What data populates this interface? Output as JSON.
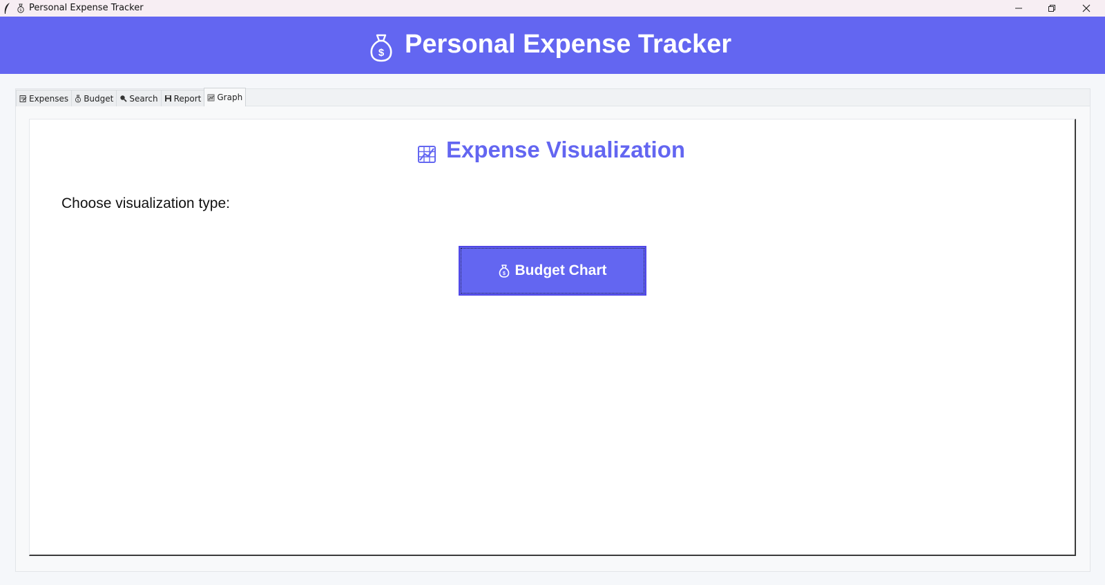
{
  "window": {
    "title": "Personal Expense Tracker",
    "controls": [
      "minimize",
      "restore",
      "close"
    ]
  },
  "header": {
    "icon": "money-bag-icon",
    "title": "Personal Expense Tracker",
    "background": "#6366f1"
  },
  "tabs": [
    {
      "label": "Expenses",
      "icon": "memo-icon",
      "active": false
    },
    {
      "label": "Budget",
      "icon": "money-bag-icon",
      "active": false
    },
    {
      "label": "Search",
      "icon": "magnifier-icon",
      "active": false
    },
    {
      "label": "Report",
      "icon": "floppy-disk-icon",
      "active": false
    },
    {
      "label": "Graph",
      "icon": "chart-icon",
      "active": true
    }
  ],
  "graph_tab": {
    "title": "Expense Visualization",
    "title_icon": "chart-icon",
    "choose_label": "Choose visualization type:",
    "buttons": [
      {
        "label": "Budget Chart",
        "icon": "money-bag-icon"
      }
    ]
  },
  "colors": {
    "accent": "#6366f1",
    "title_bar": "#f7eef3",
    "panel": "#ffffff"
  }
}
